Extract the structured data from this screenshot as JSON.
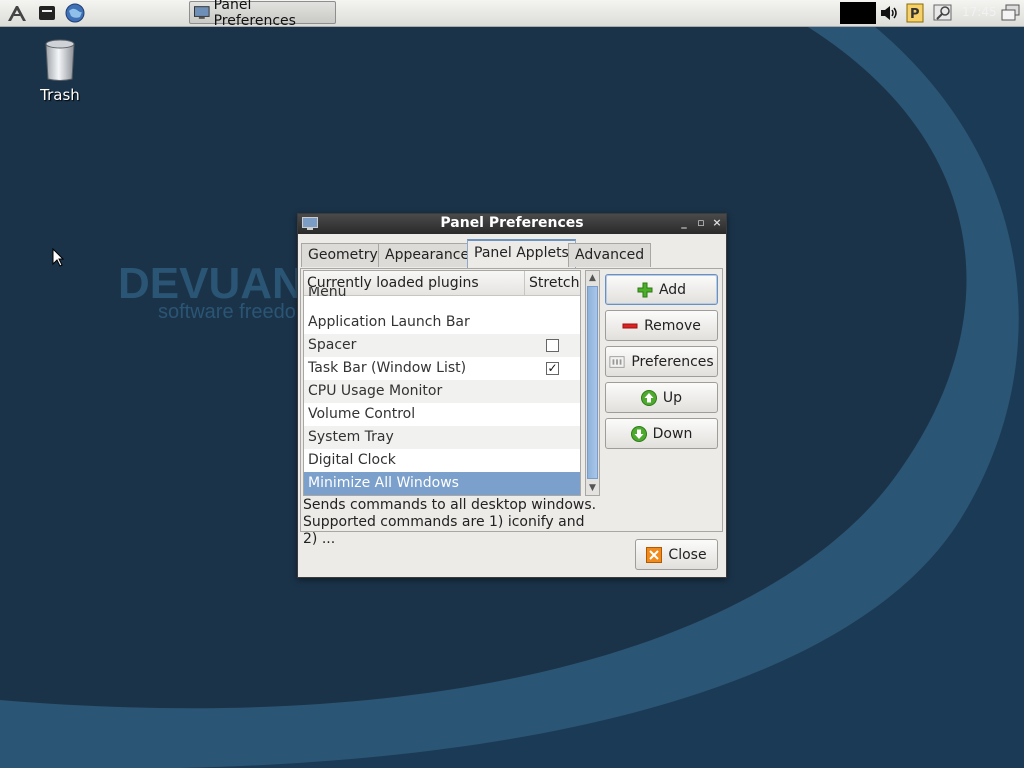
{
  "panel": {
    "task_button_label": "Panel Preferences",
    "clock_text": "17:45"
  },
  "desktop": {
    "trash_label": "Trash",
    "wallpaper_logo": "DEVUAN",
    "wallpaper_tagline": "software freedom"
  },
  "dialog": {
    "title": "Panel Preferences",
    "tabs": [
      {
        "label": "Geometry",
        "active": false
      },
      {
        "label": "Appearance",
        "active": false
      },
      {
        "label": "Panel Applets",
        "active": true
      },
      {
        "label": "Advanced",
        "active": false
      }
    ],
    "list": {
      "header_plugins": "Currently loaded plugins",
      "header_stretch": "Stretch",
      "partial_row": "Menu",
      "rows": [
        {
          "label": "Application Launch Bar",
          "checkbox": null
        },
        {
          "label": "Spacer",
          "checkbox": false
        },
        {
          "label": "Task Bar (Window List)",
          "checkbox": true
        },
        {
          "label": "CPU Usage Monitor",
          "checkbox": null
        },
        {
          "label": "Volume Control",
          "checkbox": null
        },
        {
          "label": "System Tray",
          "checkbox": null
        },
        {
          "label": "Digital Clock",
          "checkbox": null
        },
        {
          "label": "Minimize All Windows",
          "checkbox": null,
          "selected": true
        }
      ]
    },
    "description_line1": "Sends commands to all desktop windows.",
    "description_line2": "Supported commands are 1) iconify and 2) ...",
    "buttons": {
      "add": "Add",
      "remove": "Remove",
      "preferences": "Preferences",
      "up": "Up",
      "down": "Down",
      "close": "Close"
    }
  },
  "colors": {
    "desktop_bg": "#1a3349",
    "wallpaper_swoosh": "#2b5574",
    "selection": "#7ca0cc",
    "titlebar": "#2a2a2a"
  }
}
